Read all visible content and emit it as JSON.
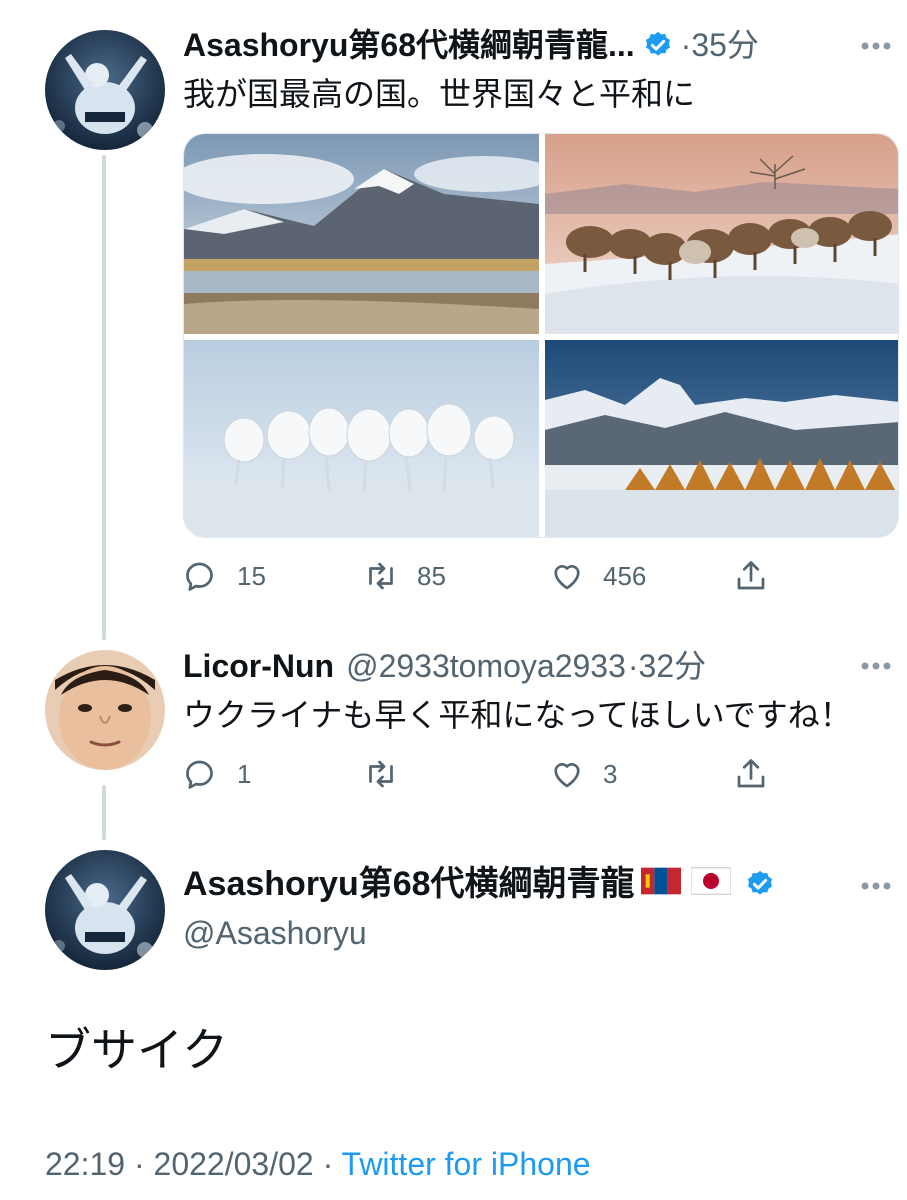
{
  "colors": {
    "accent": "#1d9bf0",
    "secondary_text": "#536471",
    "thread_line": "#cfd9de"
  },
  "tweet1": {
    "avatar_icon": "sumo-wrestler-avatar",
    "name": "Asashoryu第68代横綱朝青龍...",
    "verified_icon": "verified-badge-icon",
    "separator": "·",
    "time": "35分",
    "text": "我が国最高の国。世界国々と平和に",
    "media": [
      "mountain-landscape-photo",
      "camels-in-snow-photo",
      "white-horses-photo",
      "snowy-mountain-forest-photo"
    ],
    "actions": {
      "reply": "15",
      "retweet": "85",
      "like": "456"
    }
  },
  "tweet2": {
    "avatar_icon": "man-face-avatar",
    "name": "Licor-Nun",
    "handle": "@2933tomoya2933",
    "separator": "·",
    "time": "32分",
    "text": "ウクライナも早く平和になってほしいですね！",
    "actions": {
      "reply": "1",
      "retweet": "",
      "like": "3"
    }
  },
  "focused": {
    "avatar_icon": "sumo-wrestler-avatar",
    "name": "Asashoryu第68代横綱朝青龍",
    "flags": [
      "mongolia-flag-icon",
      "japan-flag-icon"
    ],
    "handle": "@Asashoryu",
    "text": "ブサイク",
    "time": "22:19",
    "separator": "·",
    "date": "2022/03/02",
    "source": "Twitter for iPhone"
  }
}
